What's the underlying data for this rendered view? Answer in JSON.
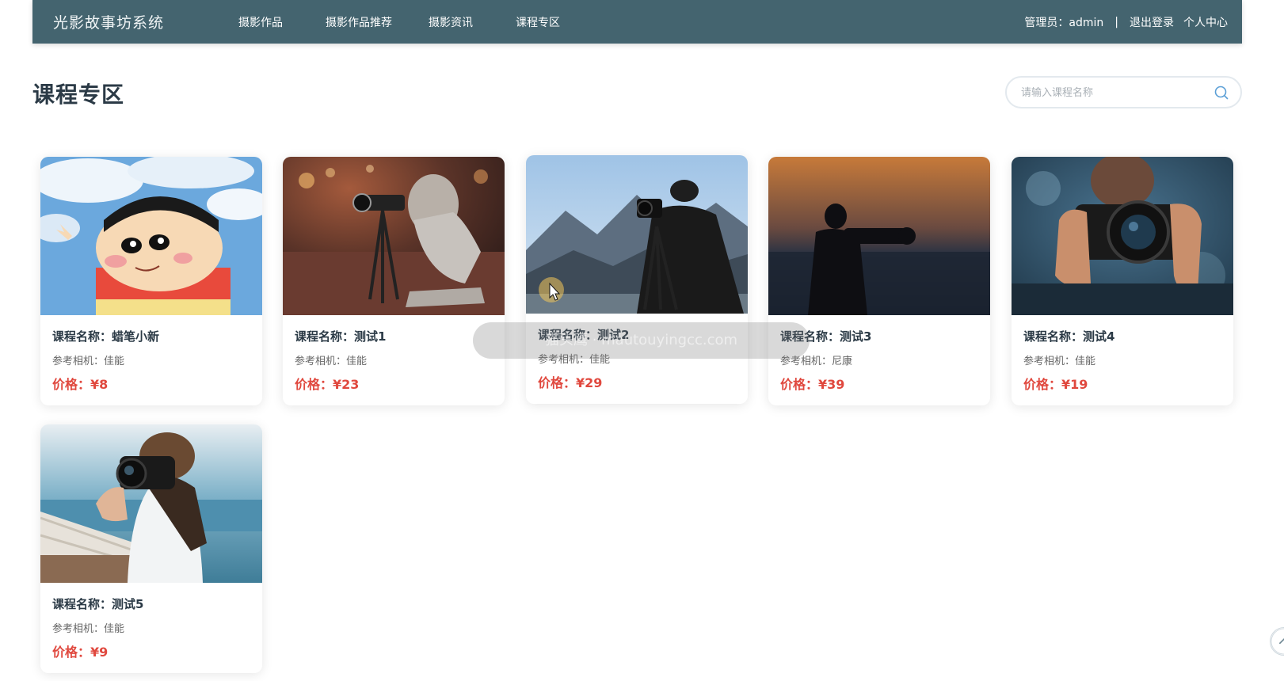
{
  "header": {
    "brand": "光影故事坊系统",
    "nav": [
      "摄影作品",
      "摄影作品推荐",
      "摄影资讯",
      "课程专区"
    ],
    "user_label": "管理员：admin",
    "separator": "|",
    "logout": "退出登录",
    "profile": "个人中心"
  },
  "page": {
    "title": "课程专区",
    "search_placeholder": "请输入课程名称"
  },
  "courses": [
    {
      "name": "课程名称：蜡笔小新",
      "camera": "参考相机：佳能",
      "price": "价格：¥8",
      "image": "cartoon-boy-sky-image"
    },
    {
      "name": "课程名称：测试1",
      "camera": "参考相机：佳能",
      "price": "价格：¥23",
      "image": "girl-with-tripod-camera-image"
    },
    {
      "name": "课程名称：测试2",
      "camera": "参考相机：佳能",
      "price": "价格：¥29",
      "image": "photographer-mountains-image"
    },
    {
      "name": "课程名称：测试3",
      "camera": "参考相机：尼康",
      "price": "价格：¥39",
      "image": "silhouette-photographer-sunset-image"
    },
    {
      "name": "课程名称：测试4",
      "camera": "参考相机：佳能",
      "price": "价格：¥19",
      "image": "hands-holding-camera-image"
    },
    {
      "name": "课程名称：测试5",
      "camera": "参考相机：佳能",
      "price": "价格：¥9",
      "image": "woman-camera-seaside-image"
    }
  ],
  "overlay": {
    "watermark": "猫头鹰 · mautouyingcc.com"
  },
  "icons": {
    "search": "search-icon",
    "scroll_top": "chevron-up-icon"
  },
  "colors": {
    "header_bg": "#44646f",
    "price": "#e0483e",
    "title": "#2b3a46"
  }
}
